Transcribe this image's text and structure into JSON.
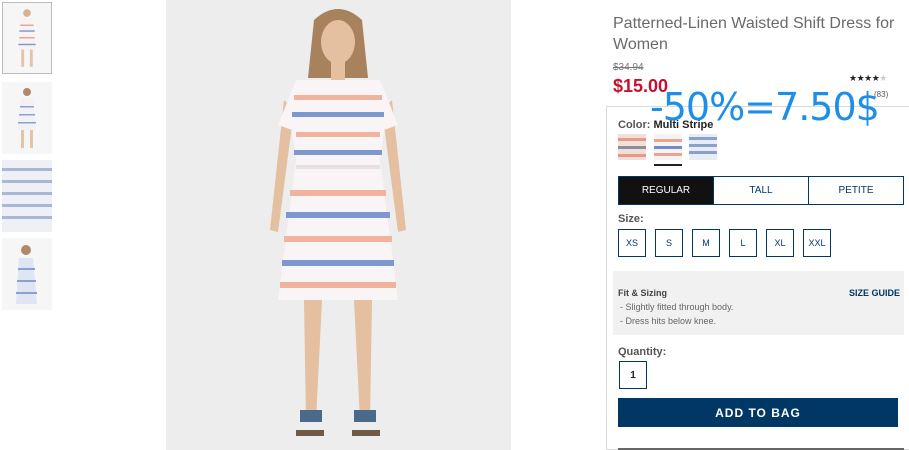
{
  "product": {
    "title": "Patterned-Linen Waisted Shift Dress for Women",
    "original_price": "$34.94",
    "sale_price": "$15.00",
    "rating_stars": "★★★★",
    "rating_empty": "★",
    "review_count": "(83)",
    "discount_annotation": "-50%=7.50$"
  },
  "color": {
    "label": "Color:",
    "value": "Multi Stripe",
    "swatches": [
      "coral-stripe-swatch",
      "multi-stripe-swatch",
      "blue-stripe-swatch"
    ],
    "selected_index": 1
  },
  "fit_tabs": [
    "REGULAR",
    "TALL",
    "PETITE"
  ],
  "fit_active": "REGULAR",
  "size": {
    "label": "Size:",
    "options": [
      "XS",
      "S",
      "M",
      "L",
      "XL",
      "XXL"
    ]
  },
  "fit_sizing": {
    "title": "Fit & Sizing",
    "guide_link": "SIZE GUIDE",
    "notes": [
      "- Slightly fitted through body.",
      "- Dress hits below knee."
    ]
  },
  "quantity": {
    "label": "Quantity:",
    "value": "1"
  },
  "add_to_bag": "ADD TO BAG",
  "colors": {
    "brand_navy": "#003764",
    "sale_red": "#c8102e",
    "annotation_blue": "#1e8fe8"
  }
}
